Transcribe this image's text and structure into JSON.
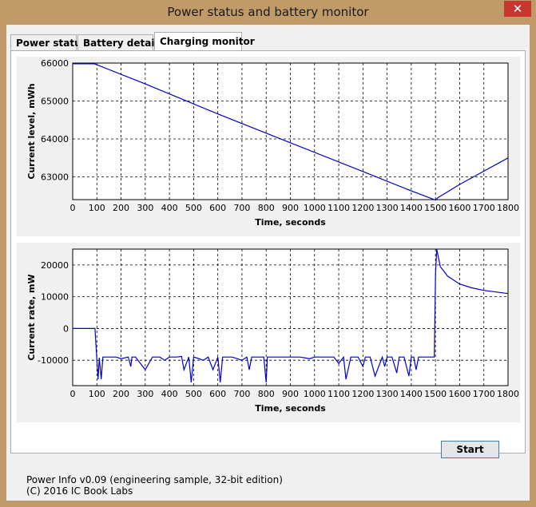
{
  "window": {
    "title": "Power status and battery monitor",
    "close_label": "✕"
  },
  "tabs": [
    {
      "label": "Power status",
      "active": false
    },
    {
      "label": "Battery details",
      "active": false
    },
    {
      "label": "Charging monitor",
      "active": true
    }
  ],
  "buttons": {
    "start_label": "Start"
  },
  "footer": {
    "line1": "Power Info v0.09 (engineering sample, 32-bit edition)",
    "line2": "(C) 2016  IC Book Labs"
  },
  "colors": {
    "frame": "#c09a68",
    "series": "#0000cc",
    "close": "#c7372f"
  },
  "chart_data": [
    {
      "type": "line",
      "xlabel": "Time, seconds",
      "ylabel": "Current level,  mWh",
      "xlim": [
        0,
        1800
      ],
      "ylim": [
        62400,
        66000
      ],
      "xticks": [
        0,
        100,
        200,
        300,
        400,
        500,
        600,
        700,
        800,
        900,
        1000,
        1100,
        1200,
        1300,
        1400,
        1500,
        1600,
        1700,
        1800
      ],
      "yticks": [
        63000,
        64000,
        65000,
        66000
      ],
      "grid": true,
      "series": [
        {
          "x": [
            0,
            90,
            300,
            600,
            900,
            1200,
            1400,
            1500,
            1510,
            1600,
            1700,
            1800
          ],
          "y": [
            65980,
            65980,
            65450,
            64660,
            63900,
            63140,
            62630,
            62390,
            62450,
            62800,
            63150,
            63500
          ]
        }
      ]
    },
    {
      "type": "line",
      "xlabel": "Time,  seconds",
      "ylabel": "Current rate,  mW",
      "xlim": [
        0,
        1800
      ],
      "ylim": [
        -18000,
        25000
      ],
      "xticks": [
        0,
        100,
        200,
        300,
        400,
        500,
        600,
        700,
        800,
        900,
        1000,
        1100,
        1200,
        1300,
        1400,
        1500,
        1600,
        1700,
        1800
      ],
      "yticks": [
        -10000,
        0,
        10000,
        20000
      ],
      "grid": true,
      "series": [
        {
          "x": [
            0,
            90,
            92,
            100,
            105,
            110,
            118,
            125,
            140,
            180,
            200,
            230,
            240,
            245,
            260,
            300,
            330,
            360,
            380,
            400,
            430,
            450,
            460,
            480,
            490,
            500,
            510,
            540,
            560,
            580,
            600,
            610,
            620,
            640,
            660,
            700,
            720,
            730,
            740,
            770,
            790,
            800,
            805,
            820,
            850,
            880,
            900,
            940,
            980,
            1000,
            1020,
            1040,
            1060,
            1080,
            1100,
            1120,
            1130,
            1150,
            1180,
            1200,
            1210,
            1230,
            1250,
            1280,
            1290,
            1300,
            1320,
            1340,
            1350,
            1370,
            1390,
            1400,
            1410,
            1420,
            1430,
            1440,
            1460,
            1480,
            1495,
            1500,
            1505,
            1520,
            1550,
            1600,
            1650,
            1700,
            1750,
            1800
          ],
          "y": [
            0,
            0,
            0,
            -10000,
            -16000,
            -9200,
            -16000,
            -9000,
            -9000,
            -9000,
            -9500,
            -9000,
            -12000,
            -9000,
            -9000,
            -13000,
            -9000,
            -9000,
            -10000,
            -9000,
            -9000,
            -8800,
            -13000,
            -9000,
            -17000,
            -9000,
            -9200,
            -10000,
            -9000,
            -13000,
            -9000,
            -17000,
            -9000,
            -9000,
            -9000,
            -10000,
            -9000,
            -13000,
            -9000,
            -9000,
            -9000,
            -17000,
            -9000,
            -9000,
            -9000,
            -9000,
            -9000,
            -9000,
            -9500,
            -9000,
            -9000,
            -9000,
            -9000,
            -9000,
            -11000,
            -9000,
            -16000,
            -9000,
            -9000,
            -12000,
            -9000,
            -9000,
            -15000,
            -9000,
            -12000,
            -9000,
            -9000,
            -14000,
            -9000,
            -9000,
            -15000,
            -9000,
            -9000,
            -13000,
            -9000,
            -9000,
            -9000,
            -9000,
            -9000,
            17000,
            25000,
            19500,
            16500,
            14000,
            12800,
            12000,
            11500,
            11000
          ]
        }
      ]
    }
  ]
}
